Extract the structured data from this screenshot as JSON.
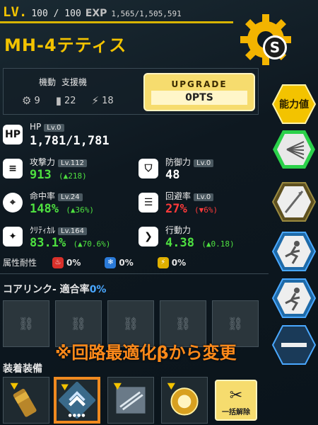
{
  "header": {
    "lv_label": "LV.",
    "lv_value": "100 / 100",
    "exp_label": "EXP",
    "exp_value": "1,565/1,505,591",
    "exp_progress": 1.0
  },
  "unit": {
    "name": "MH-4テティス"
  },
  "settings_badge": "S",
  "info": {
    "class_label": "機動",
    "class_value": "支援機",
    "resources": [
      {
        "icon": "gear-icon",
        "value": "9"
      },
      {
        "icon": "canister-icon",
        "value": "22"
      },
      {
        "icon": "lightning-icon",
        "value": "18"
      }
    ]
  },
  "upgrade": {
    "title": "UPGRADE",
    "points": "0PTS"
  },
  "side_tabs": [
    {
      "label": "能力値",
      "icon": ""
    },
    {
      "label": "",
      "icon": "skill-spread-icon"
    },
    {
      "label": "",
      "icon": "spear-icon"
    },
    {
      "label": "",
      "icon": "runner-icon"
    },
    {
      "label": "",
      "icon": "runner-icon"
    },
    {
      "label": "",
      "icon": "empty-icon"
    }
  ],
  "stats": {
    "hp": {
      "icon_text": "HP",
      "name": "HP",
      "lv": "Lv.0",
      "value": "1,781/1,781",
      "delta": ""
    },
    "attack": {
      "name": "攻撃力",
      "lv": "Lv.112",
      "value": "913",
      "delta": "(▲218)"
    },
    "defense": {
      "name": "防御力",
      "lv": "Lv.0",
      "value": "48",
      "delta": ""
    },
    "accuracy": {
      "name": "命中率",
      "lv": "Lv.24",
      "value": "148%",
      "delta": "(▲36%)"
    },
    "evasion": {
      "name": "回避率",
      "lv": "Lv.0",
      "value": "27%",
      "delta": "(▼6%)"
    },
    "critical": {
      "name": "ｸﾘﾃｨｶﾙ",
      "lv": "Lv.164",
      "value": "83.1%",
      "delta": "(▲70.6%)"
    },
    "mobility": {
      "name": "行動力",
      "lv": "",
      "value": "4.38",
      "delta": "(▲0.18)"
    }
  },
  "resist": {
    "label": "属性耐性",
    "fire": "0%",
    "ice": "0%",
    "electric": "0%"
  },
  "core_link": {
    "label": "コアリンク- 適合率",
    "rate": "0%"
  },
  "note": "※回路最適化βから変更",
  "equip": {
    "label": "装着装備",
    "release_label": "一括解除"
  },
  "colors": {
    "accent_yellow": "#f3c300",
    "green": "#4ee040",
    "red": "#ff3a3a",
    "blue": "#4aa8ff",
    "orange": "#f08a20"
  }
}
